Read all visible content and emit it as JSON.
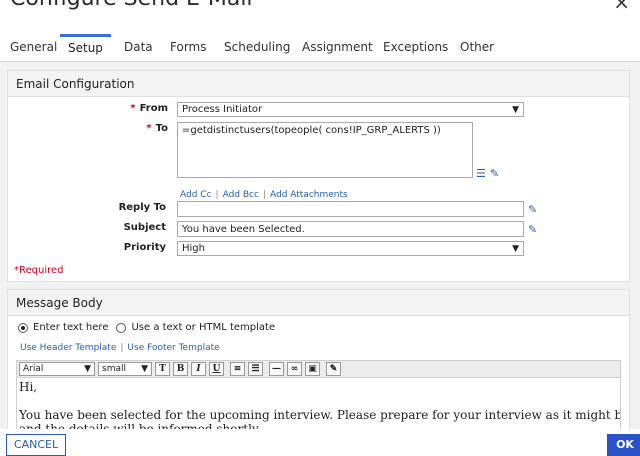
{
  "dialog": {
    "title": "Configure Send E-Mail",
    "close_glyph": "×"
  },
  "tabs": [
    {
      "label": "General"
    },
    {
      "label": "Setup",
      "active": true
    },
    {
      "label": "Data"
    },
    {
      "label": "Forms"
    },
    {
      "label": "Scheduling"
    },
    {
      "label": "Assignment"
    },
    {
      "label": "Exceptions"
    },
    {
      "label": "Other"
    }
  ],
  "email_config": {
    "header": "Email Configuration",
    "from_label": "From",
    "from_value": "Process Initiator",
    "to_label": "To",
    "to_value": "=getdistinctusers(topeople( cons!IP_GRP_ALERTS ))",
    "add_cc": "Add Cc",
    "add_bcc": "Add Bcc",
    "add_attachments": "Add Attachments",
    "reply_to_label": "Reply To",
    "reply_to_value": "",
    "subject_label": "Subject",
    "subject_value": "You have been Selected.",
    "priority_label": "Priority",
    "priority_value": "High",
    "required_note": "*Required",
    "separator": "|",
    "star": "*"
  },
  "message_body": {
    "header": "Message Body",
    "option_text": "Enter text here",
    "option_template": "Use a text or HTML template",
    "use_header_template": "Use Header Template",
    "use_footer_template": "Use Footer Template",
    "font_value": "Arial",
    "size_value": "small",
    "editor_line1": "Hi,",
    "editor_line2": "You have been selected for the upcoming interview. Please prepare for your interview as it might be held soon",
    "editor_line3": "and the details will be informed shortly."
  },
  "footer": {
    "cancel_label": "CANCEL",
    "ok_label": "OK"
  },
  "colors": {
    "accent": "#2a52c9",
    "link": "#2a5db0",
    "required": "#d0021b"
  }
}
